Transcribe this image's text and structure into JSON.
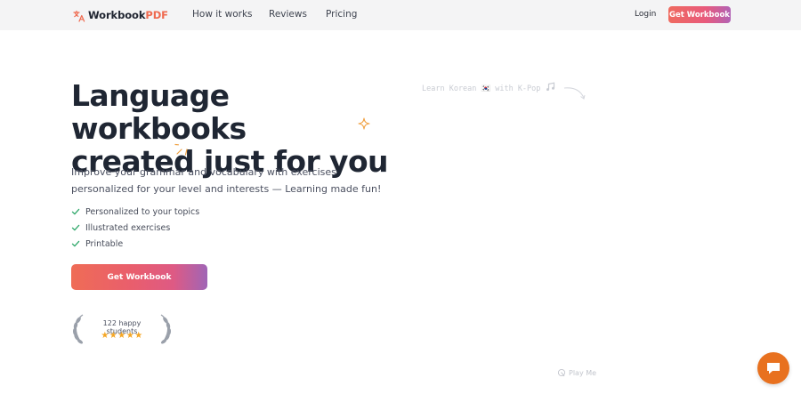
{
  "nav": {
    "brand": {
      "part1": "Workbook",
      "part2": "PDF"
    },
    "links": [
      "How it works",
      "Reviews",
      "Pricing"
    ],
    "login": "Login",
    "cta": "Get Workbook"
  },
  "hero": {
    "headline_line1": "Language workbooks",
    "headline_line2": "created just for you",
    "subtitle": "Improve your grammar and vocabulary with exercises personalized for your level and interests — Learning made fun!",
    "features": [
      "Personalized to your topics",
      "Illustrated exercises",
      "Printable"
    ],
    "cta": "Get Workbook",
    "social_proof": {
      "text": "122 happy students",
      "rating": 5,
      "stars": "★★★★★"
    }
  },
  "annotation": {
    "text": "Learn Korean 🇰🇷 with K-Pop"
  },
  "play": {
    "label": "Play Me"
  },
  "colors": {
    "accent": "#ef6a4f",
    "gradient_end": "#a065b6",
    "check": "#2fa86a",
    "star": "#f5a623",
    "chat": "#e8711f"
  },
  "icons": [
    "translate-icon",
    "sparkle-icon",
    "check-icon",
    "laurel-icon",
    "music-note-icon",
    "cursor-icon",
    "chat-icon"
  ]
}
